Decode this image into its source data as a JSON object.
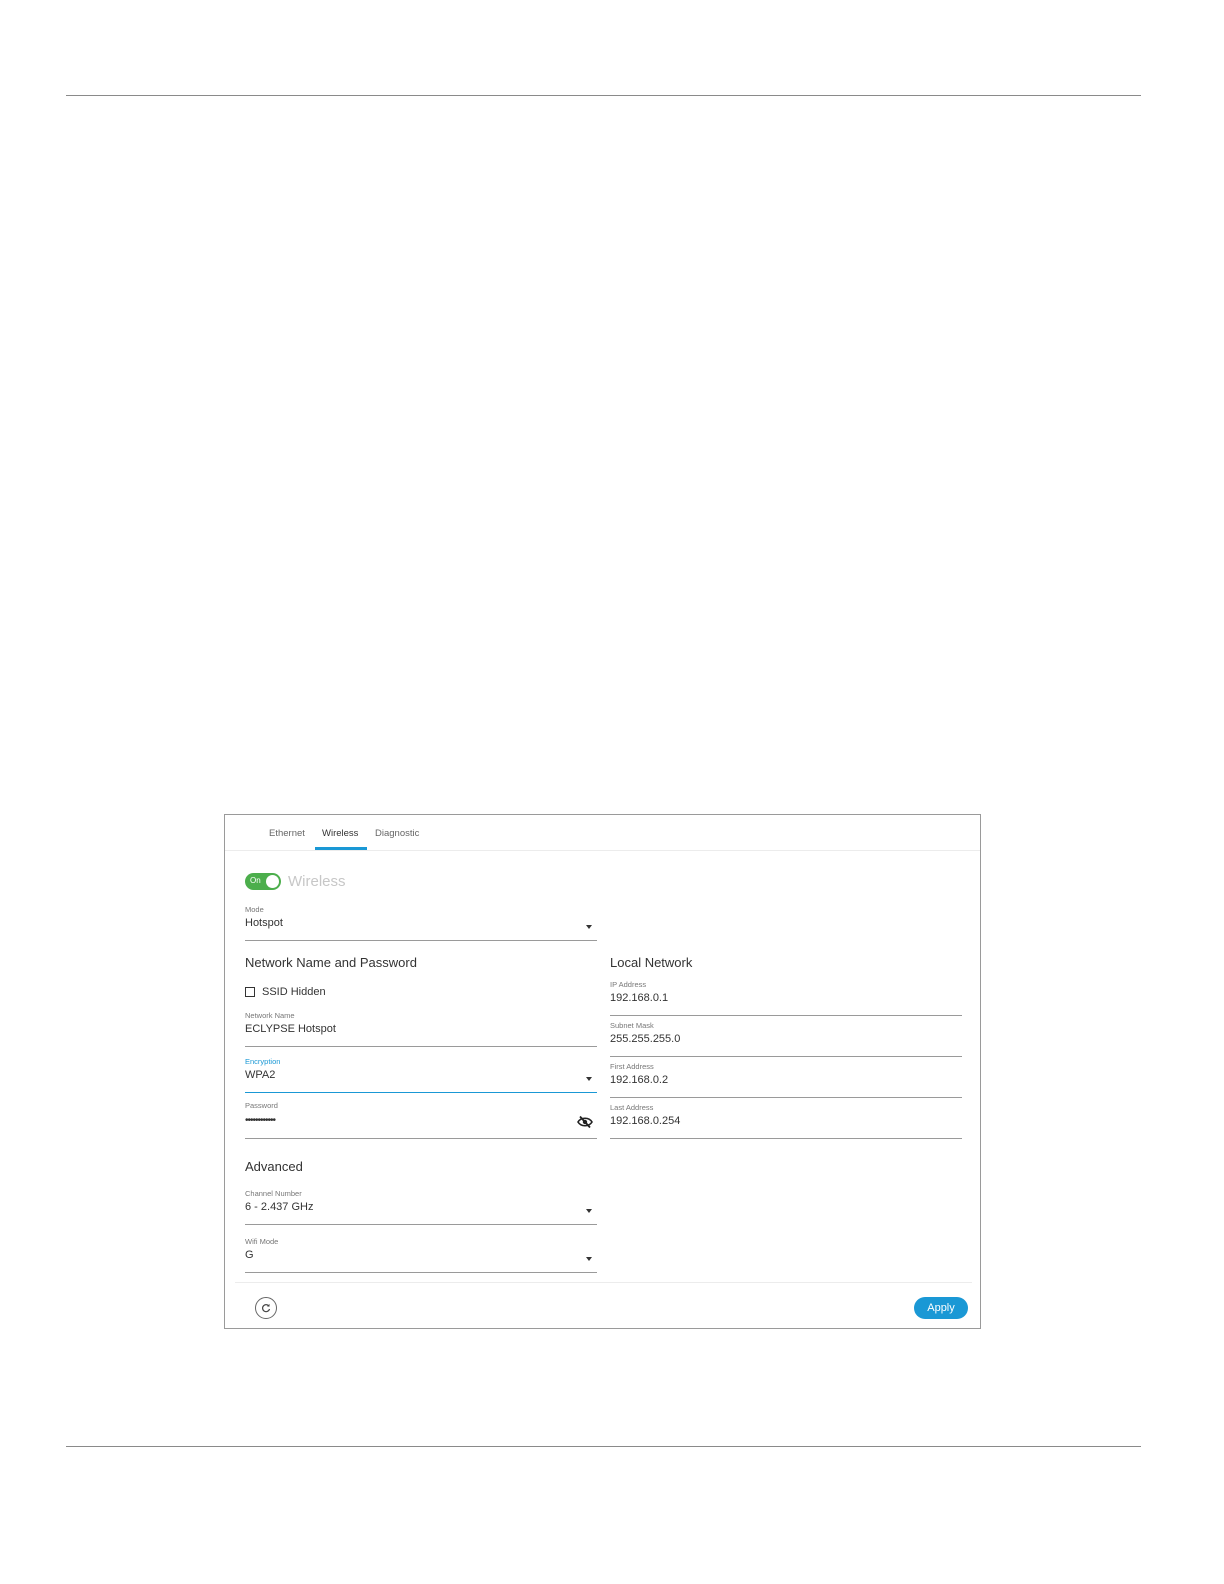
{
  "tabs": [
    {
      "label": "Ethernet"
    },
    {
      "label": "Wireless"
    },
    {
      "label": "Diagnostic"
    }
  ],
  "wireless": {
    "toggle_label": "On",
    "title": "Wireless",
    "enabled": true
  },
  "mode": {
    "label": "Mode",
    "value": "Hotspot"
  },
  "network_section": {
    "title": "Network Name and Password",
    "ssid_hidden_label": "SSID Hidden",
    "ssid_hidden_checked": false,
    "network_name": {
      "label": "Network Name",
      "value": "ECLYPSE Hotspot"
    },
    "encryption": {
      "label": "Encryption",
      "value": "WPA2"
    },
    "password": {
      "label": "Password",
      "value": "••••••••••••"
    }
  },
  "advanced_section": {
    "title": "Advanced",
    "channel": {
      "label": "Channel Number",
      "value": "6 - 2.437 GHz"
    },
    "wifi_mode": {
      "label": "Wifi Mode",
      "value": "G"
    }
  },
  "local_network": {
    "title": "Local Network",
    "ip": {
      "label": "IP Address",
      "value": "192.168.0.1"
    },
    "subnet": {
      "label": "Subnet Mask",
      "value": "255.255.255.0"
    },
    "first": {
      "label": "First Address",
      "value": "192.168.0.2"
    },
    "last": {
      "label": "Last Address",
      "value": "192.168.0.254"
    }
  },
  "footer": {
    "apply_label": "Apply"
  },
  "colors": {
    "accent": "#1a98d5",
    "toggle_on": "#4cae4c"
  },
  "icons": {
    "reset": "refresh-icon",
    "password_visibility": "eye-off-icon"
  }
}
